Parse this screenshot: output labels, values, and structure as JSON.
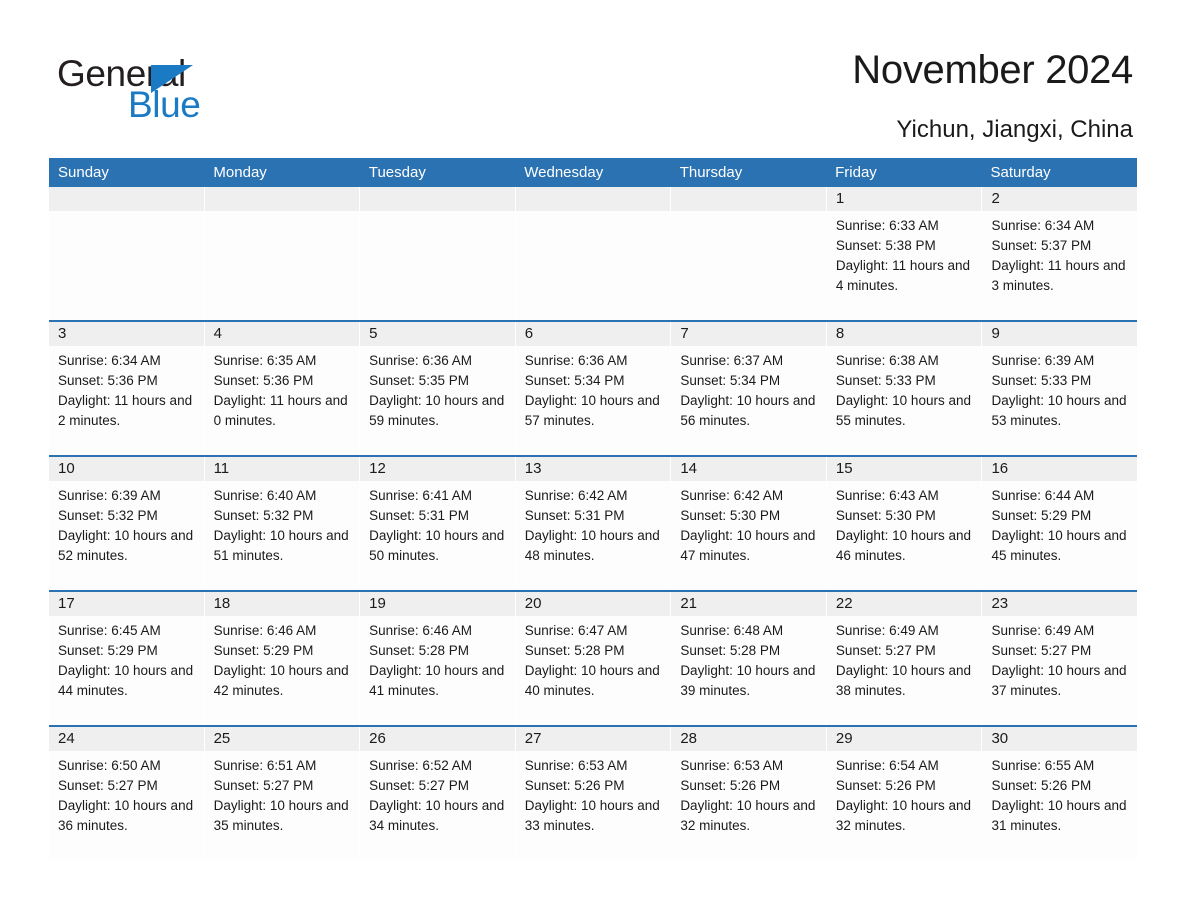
{
  "brand": {
    "name_part1": "General",
    "name_part2": "Blue",
    "triangle_icon": "blue-triangle-icon",
    "accent_color": "#1a7ac4"
  },
  "header": {
    "title": "November 2024",
    "subtitle": "Yichun, Jiangxi, China"
  },
  "calendar": {
    "header_bg": "#2b72b2",
    "daynum_bg": "#efefef",
    "separator_color": "#2b72b2",
    "weekdays": [
      "Sunday",
      "Monday",
      "Tuesday",
      "Wednesday",
      "Thursday",
      "Friday",
      "Saturday"
    ],
    "weeks": [
      [
        {
          "day": "",
          "sunrise": "",
          "sunset": "",
          "daylight": ""
        },
        {
          "day": "",
          "sunrise": "",
          "sunset": "",
          "daylight": ""
        },
        {
          "day": "",
          "sunrise": "",
          "sunset": "",
          "daylight": ""
        },
        {
          "day": "",
          "sunrise": "",
          "sunset": "",
          "daylight": ""
        },
        {
          "day": "",
          "sunrise": "",
          "sunset": "",
          "daylight": ""
        },
        {
          "day": "1",
          "sunrise": "Sunrise: 6:33 AM",
          "sunset": "Sunset: 5:38 PM",
          "daylight": "Daylight: 11 hours and 4 minutes."
        },
        {
          "day": "2",
          "sunrise": "Sunrise: 6:34 AM",
          "sunset": "Sunset: 5:37 PM",
          "daylight": "Daylight: 11 hours and 3 minutes."
        }
      ],
      [
        {
          "day": "3",
          "sunrise": "Sunrise: 6:34 AM",
          "sunset": "Sunset: 5:36 PM",
          "daylight": "Daylight: 11 hours and 2 minutes."
        },
        {
          "day": "4",
          "sunrise": "Sunrise: 6:35 AM",
          "sunset": "Sunset: 5:36 PM",
          "daylight": "Daylight: 11 hours and 0 minutes."
        },
        {
          "day": "5",
          "sunrise": "Sunrise: 6:36 AM",
          "sunset": "Sunset: 5:35 PM",
          "daylight": "Daylight: 10 hours and 59 minutes."
        },
        {
          "day": "6",
          "sunrise": "Sunrise: 6:36 AM",
          "sunset": "Sunset: 5:34 PM",
          "daylight": "Daylight: 10 hours and 57 minutes."
        },
        {
          "day": "7",
          "sunrise": "Sunrise: 6:37 AM",
          "sunset": "Sunset: 5:34 PM",
          "daylight": "Daylight: 10 hours and 56 minutes."
        },
        {
          "day": "8",
          "sunrise": "Sunrise: 6:38 AM",
          "sunset": "Sunset: 5:33 PM",
          "daylight": "Daylight: 10 hours and 55 minutes."
        },
        {
          "day": "9",
          "sunrise": "Sunrise: 6:39 AM",
          "sunset": "Sunset: 5:33 PM",
          "daylight": "Daylight: 10 hours and 53 minutes."
        }
      ],
      [
        {
          "day": "10",
          "sunrise": "Sunrise: 6:39 AM",
          "sunset": "Sunset: 5:32 PM",
          "daylight": "Daylight: 10 hours and 52 minutes."
        },
        {
          "day": "11",
          "sunrise": "Sunrise: 6:40 AM",
          "sunset": "Sunset: 5:32 PM",
          "daylight": "Daylight: 10 hours and 51 minutes."
        },
        {
          "day": "12",
          "sunrise": "Sunrise: 6:41 AM",
          "sunset": "Sunset: 5:31 PM",
          "daylight": "Daylight: 10 hours and 50 minutes."
        },
        {
          "day": "13",
          "sunrise": "Sunrise: 6:42 AM",
          "sunset": "Sunset: 5:31 PM",
          "daylight": "Daylight: 10 hours and 48 minutes."
        },
        {
          "day": "14",
          "sunrise": "Sunrise: 6:42 AM",
          "sunset": "Sunset: 5:30 PM",
          "daylight": "Daylight: 10 hours and 47 minutes."
        },
        {
          "day": "15",
          "sunrise": "Sunrise: 6:43 AM",
          "sunset": "Sunset: 5:30 PM",
          "daylight": "Daylight: 10 hours and 46 minutes."
        },
        {
          "day": "16",
          "sunrise": "Sunrise: 6:44 AM",
          "sunset": "Sunset: 5:29 PM",
          "daylight": "Daylight: 10 hours and 45 minutes."
        }
      ],
      [
        {
          "day": "17",
          "sunrise": "Sunrise: 6:45 AM",
          "sunset": "Sunset: 5:29 PM",
          "daylight": "Daylight: 10 hours and 44 minutes."
        },
        {
          "day": "18",
          "sunrise": "Sunrise: 6:46 AM",
          "sunset": "Sunset: 5:29 PM",
          "daylight": "Daylight: 10 hours and 42 minutes."
        },
        {
          "day": "19",
          "sunrise": "Sunrise: 6:46 AM",
          "sunset": "Sunset: 5:28 PM",
          "daylight": "Daylight: 10 hours and 41 minutes."
        },
        {
          "day": "20",
          "sunrise": "Sunrise: 6:47 AM",
          "sunset": "Sunset: 5:28 PM",
          "daylight": "Daylight: 10 hours and 40 minutes."
        },
        {
          "day": "21",
          "sunrise": "Sunrise: 6:48 AM",
          "sunset": "Sunset: 5:28 PM",
          "daylight": "Daylight: 10 hours and 39 minutes."
        },
        {
          "day": "22",
          "sunrise": "Sunrise: 6:49 AM",
          "sunset": "Sunset: 5:27 PM",
          "daylight": "Daylight: 10 hours and 38 minutes."
        },
        {
          "day": "23",
          "sunrise": "Sunrise: 6:49 AM",
          "sunset": "Sunset: 5:27 PM",
          "daylight": "Daylight: 10 hours and 37 minutes."
        }
      ],
      [
        {
          "day": "24",
          "sunrise": "Sunrise: 6:50 AM",
          "sunset": "Sunset: 5:27 PM",
          "daylight": "Daylight: 10 hours and 36 minutes."
        },
        {
          "day": "25",
          "sunrise": "Sunrise: 6:51 AM",
          "sunset": "Sunset: 5:27 PM",
          "daylight": "Daylight: 10 hours and 35 minutes."
        },
        {
          "day": "26",
          "sunrise": "Sunrise: 6:52 AM",
          "sunset": "Sunset: 5:27 PM",
          "daylight": "Daylight: 10 hours and 34 minutes."
        },
        {
          "day": "27",
          "sunrise": "Sunrise: 6:53 AM",
          "sunset": "Sunset: 5:26 PM",
          "daylight": "Daylight: 10 hours and 33 minutes."
        },
        {
          "day": "28",
          "sunrise": "Sunrise: 6:53 AM",
          "sunset": "Sunset: 5:26 PM",
          "daylight": "Daylight: 10 hours and 32 minutes."
        },
        {
          "day": "29",
          "sunrise": "Sunrise: 6:54 AM",
          "sunset": "Sunset: 5:26 PM",
          "daylight": "Daylight: 10 hours and 32 minutes."
        },
        {
          "day": "30",
          "sunrise": "Sunrise: 6:55 AM",
          "sunset": "Sunset: 5:26 PM",
          "daylight": "Daylight: 10 hours and 31 minutes."
        }
      ]
    ]
  }
}
